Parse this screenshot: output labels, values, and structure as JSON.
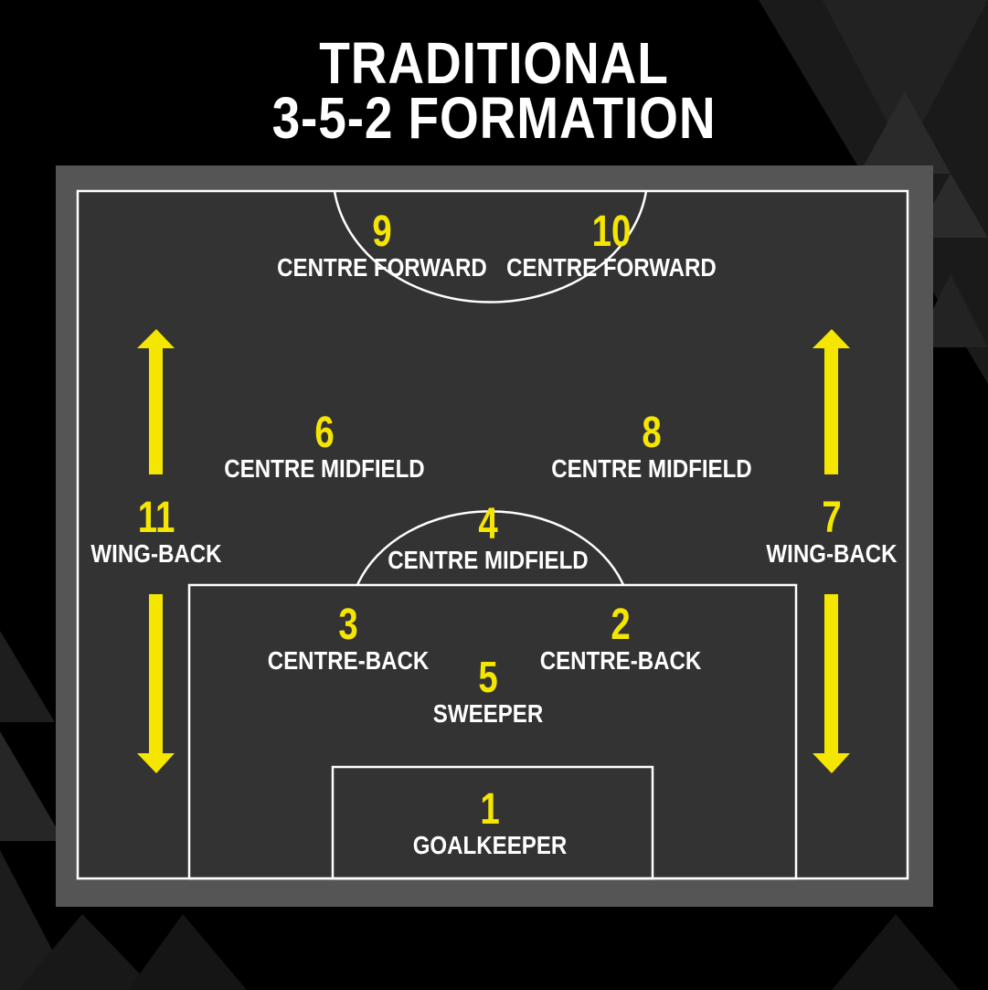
{
  "title": {
    "line1": "TRADITIONAL",
    "line2": "3-5-2 FORMATION"
  },
  "colors": {
    "background": "#000000",
    "pitch_border": "#555555",
    "pitch": "#333333",
    "lines": "#ffffff",
    "numbers": "#f5e600",
    "arrows": "#f5e600"
  },
  "players": {
    "p9": {
      "number": "9",
      "role": "CENTRE FORWARD"
    },
    "p10": {
      "number": "10",
      "role": "CENTRE FORWARD"
    },
    "p6": {
      "number": "6",
      "role": "CENTRE MIDFIELD"
    },
    "p8": {
      "number": "8",
      "role": "CENTRE MIDFIELD"
    },
    "p11": {
      "number": "11",
      "role": "WING-BACK"
    },
    "p7": {
      "number": "7",
      "role": "WING-BACK"
    },
    "p4": {
      "number": "4",
      "role": "CENTRE MIDFIELD"
    },
    "p3": {
      "number": "3",
      "role": "CENTRE-BACK"
    },
    "p2": {
      "number": "2",
      "role": "CENTRE-BACK"
    },
    "p5": {
      "number": "5",
      "role": "SWEEPER"
    },
    "p1": {
      "number": "1",
      "role": "GOALKEEPER"
    }
  }
}
